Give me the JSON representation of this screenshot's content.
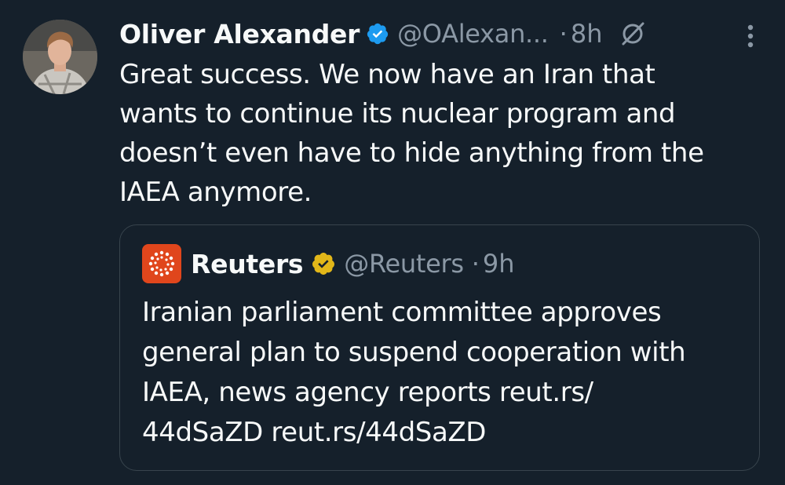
{
  "tweet": {
    "author_name": "Oliver Alexander",
    "author_handle": "@OAlexan...",
    "dot": "·",
    "time": "8h",
    "text_lines": [
      "Great success. We now have an Iran that",
      "wants to continue its nuclear program and",
      "doesn’t even have to hide anything from the",
      "IAEA anymore."
    ]
  },
  "quote": {
    "author_name": "Reuters",
    "author_handle": "@Reuters",
    "dot": "·",
    "time": "9h",
    "text_lines": [
      "Iranian parliament committee approves",
      "general plan to suspend cooperation with",
      "IAEA, news agency reports reut.rs/",
      "44dSaZD reut.rs/44dSaZD"
    ]
  },
  "colors": {
    "background": "#15202b",
    "text": "#f7f9f9",
    "muted": "#8b98a5",
    "verified_blue": "#1d9bf0",
    "verified_gold": "#e2b719",
    "reuters_orange": "#e0461c"
  },
  "icons": {
    "verified": "verified-badge-icon",
    "grok": "grok-icon",
    "more": "more-vertical-icon",
    "reuters_logo": "reuters-logo-icon",
    "gold_verified": "gold-verified-badge-icon"
  }
}
